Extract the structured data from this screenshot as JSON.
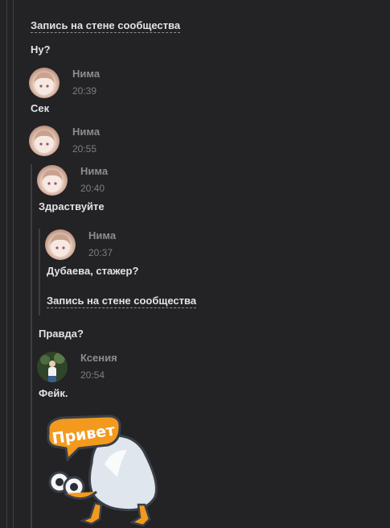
{
  "colors": {
    "background": "#232225",
    "rail": "#3d3d42",
    "text": "#e1e3e6",
    "muted": "#8a8d92",
    "sticker_bubble": "#f39a1e"
  },
  "top_link": "Запись на стене сообщества",
  "messages": {
    "m1_text": "Ну?",
    "m2": {
      "author": "Нима",
      "time": "20:39",
      "text": "Сек"
    },
    "m3": {
      "author": "Нима",
      "time": "20:55"
    },
    "fwd1": {
      "author": "Нима",
      "time": "20:40",
      "text": "Здраствуйте"
    },
    "fwd2": {
      "author": "Нима",
      "time": "20:37",
      "text": "Дубаева, стажер?",
      "link": "Запись на стене сообщества"
    },
    "fwd1_text2": "Правда?",
    "fwd3": {
      "author": "Ксения",
      "time": "20:54",
      "text": "Фейк."
    }
  },
  "sticker": {
    "caption": "Привет",
    "icon": "duck-sticker"
  }
}
